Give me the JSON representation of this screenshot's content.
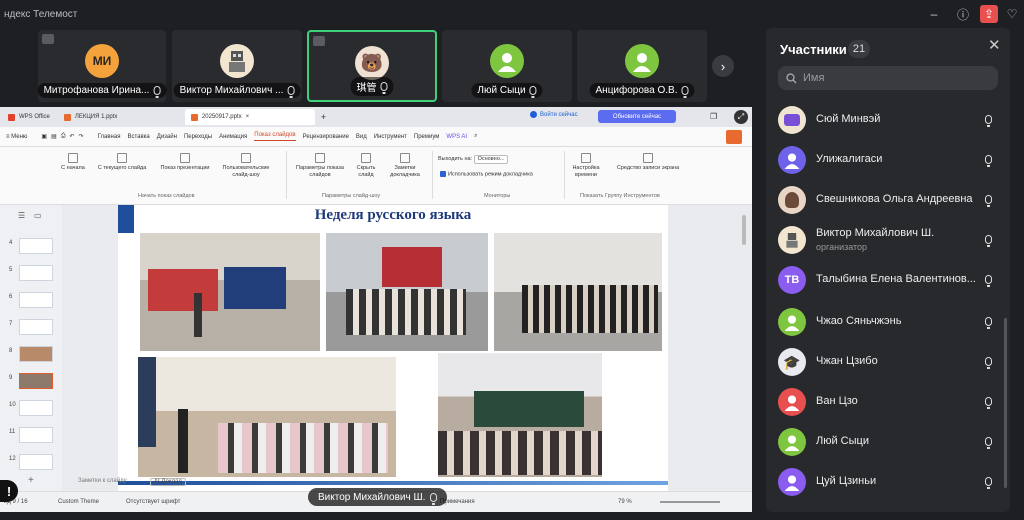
{
  "app": {
    "title": "ндекс Телемост"
  },
  "tiles": [
    {
      "initials": "МИ",
      "name": "Митрофанова Ирина...",
      "avatar_color": "#f4a33c"
    },
    {
      "initials": "",
      "name": "Виктор Михайлович ...",
      "avatar_color": "#f2e6d0"
    },
    {
      "initials": "",
      "name": "琪管",
      "avatar_color": "#e9e0d5",
      "active": true
    },
    {
      "initials": "",
      "name": "Люй Сыци",
      "avatar_color": "#7ec63f"
    },
    {
      "initials": "",
      "name": "Анцифорова О.В.",
      "avatar_color": "#7ec63f"
    }
  ],
  "wps": {
    "tabs": [
      "WPS Office",
      "ЛЕКЦИЯ 1.pptx",
      "20250917.pptx"
    ],
    "login": "Войти сейчас",
    "update": "Обновите сейчас",
    "menu_label": "Меню",
    "menu": [
      "Главная",
      "Вставка",
      "Дизайн",
      "Переходы",
      "Анимация",
      "Показ слайдов",
      "Рецензирование",
      "Вид",
      "Инструмент",
      "Премиум",
      "WPS AI"
    ],
    "ribbon": {
      "from_start": "С начала",
      "from_current": "С текущего слайда",
      "show_presentation": "Показ презентации",
      "custom_show": "Пользовательские слайд-шоу",
      "group_start": "Начать показ слайдов",
      "params": "Параметры показа слайдов",
      "hide": "Скрыть слайд",
      "notes": "Заметки докладчика",
      "group_params": "Параметры слайд-шоу",
      "output_label": "Выходить на:",
      "output_value": "Основно...",
      "presenter_mode": "Использовать режим докладчика",
      "group_monitors": "Мониторы",
      "timing": "Настройка времени",
      "record": "Средство записи экрана",
      "group_tools": "Показать Группу Инструментов"
    },
    "slide_numbers": [
      "4",
      "5",
      "6",
      "7",
      "8",
      "9",
      "10",
      "11",
      "12"
    ],
    "slide_title": "Неделя русского языка",
    "status": {
      "slide": "ид 9 / 16",
      "theme": "Custom Theme",
      "font": "Отсутствует шрифт",
      "notes_hint": "Заметки к слайду",
      "ai": "AI Доклад",
      "notes_btn": "Примечания",
      "zoom": "79 %"
    }
  },
  "presenter": {
    "name": "Виктор Михайлович Ш."
  },
  "participants": {
    "title": "Участники",
    "count": "21",
    "search_placeholder": "Имя",
    "items": [
      {
        "name": "Сюй Минвэй",
        "initials": "",
        "color": "#efe5d0"
      },
      {
        "name": "Улижалигаси",
        "initials": "",
        "color": "#6e63e8"
      },
      {
        "name": "Свешникова Ольга Андреевна",
        "initials": "",
        "color": "#e9d5c5"
      },
      {
        "name": "Виктор Михайлович Ш.",
        "role": "организатор",
        "initials": "",
        "color": "#f2e6d0"
      },
      {
        "name": "Талыбина Елена Валентинов...",
        "initials": "ТВ",
        "color": "#8a5cf0"
      },
      {
        "name": "Чжао Сяньчжэнь",
        "initials": "",
        "color": "#7ec63f"
      },
      {
        "name": "Чжан Цзибо",
        "initials": "",
        "color": "#e8eaf0"
      },
      {
        "name": "Ван Цзо",
        "initials": "",
        "color": "#e8504f"
      },
      {
        "name": "Люй Сыци",
        "initials": "",
        "color": "#7ec63f"
      },
      {
        "name": "Цуй Цзиньи",
        "initials": "",
        "color": "#8a5cf0"
      }
    ]
  }
}
